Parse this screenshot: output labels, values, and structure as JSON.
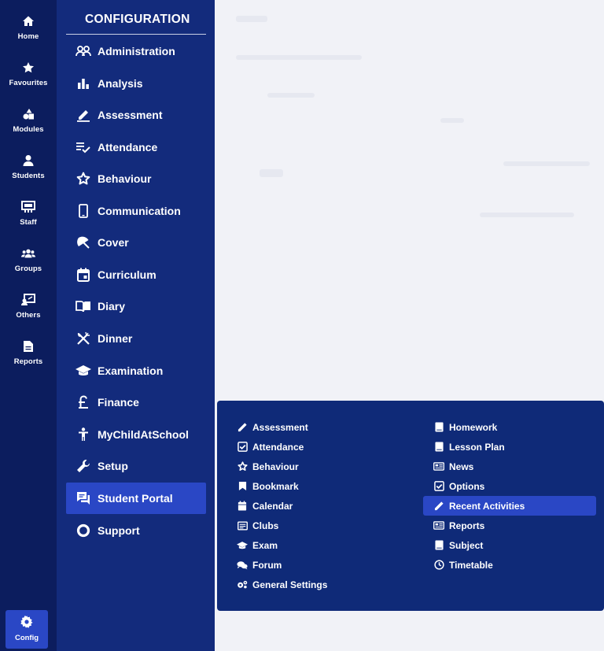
{
  "rail": {
    "items": [
      {
        "label": "Home",
        "icon": "home-icon"
      },
      {
        "label": "Favourites",
        "icon": "star-icon"
      },
      {
        "label": "Modules",
        "icon": "modules-icon"
      },
      {
        "label": "Students",
        "icon": "person-icon"
      },
      {
        "label": "Staff",
        "icon": "staff-icon"
      },
      {
        "label": "Groups",
        "icon": "groups-icon"
      },
      {
        "label": "Others",
        "icon": "others-icon"
      },
      {
        "label": "Reports",
        "icon": "document-icon"
      }
    ],
    "config": {
      "label": "Config",
      "icon": "gear-icon"
    }
  },
  "panel": {
    "title": "CONFIGURATION",
    "items": [
      {
        "label": "Administration",
        "icon": "people-icon"
      },
      {
        "label": "Analysis",
        "icon": "bar-chart-icon"
      },
      {
        "label": "Assessment",
        "icon": "pen-icon"
      },
      {
        "label": "Attendance",
        "icon": "checklist-icon"
      },
      {
        "label": "Behaviour",
        "icon": "star-outline-icon"
      },
      {
        "label": "Communication",
        "icon": "phone-icon"
      },
      {
        "label": "Cover",
        "icon": "umbrella-icon"
      },
      {
        "label": "Curriculum",
        "icon": "calendar-icon"
      },
      {
        "label": "Diary",
        "icon": "book-open-icon"
      },
      {
        "label": "Dinner",
        "icon": "cutlery-icon"
      },
      {
        "label": "Examination",
        "icon": "graduation-cap-icon"
      },
      {
        "label": "Finance",
        "icon": "pound-icon"
      },
      {
        "label": "MyChildAtSchool",
        "icon": "child-icon"
      },
      {
        "label": "Setup",
        "icon": "wrench-icon"
      },
      {
        "label": "Student Portal",
        "icon": "chat-icon",
        "active": true
      },
      {
        "label": "Support",
        "icon": "ring-icon"
      }
    ]
  },
  "submenu": {
    "left": [
      {
        "label": "Assessment",
        "icon": "pencil-icon"
      },
      {
        "label": "Attendance",
        "icon": "checkbox-icon"
      },
      {
        "label": "Behaviour",
        "icon": "star-outline-icon"
      },
      {
        "label": "Bookmark",
        "icon": "bookmark-icon"
      },
      {
        "label": "Calendar",
        "icon": "calendar-icon"
      },
      {
        "label": "Clubs",
        "icon": "list-box-icon"
      },
      {
        "label": "Exam",
        "icon": "graduation-cap-icon"
      },
      {
        "label": "Forum",
        "icon": "comments-icon"
      },
      {
        "label": "General Settings",
        "icon": "gears-icon"
      }
    ],
    "right": [
      {
        "label": "Homework",
        "icon": "book-icon"
      },
      {
        "label": "Lesson Plan",
        "icon": "book-icon"
      },
      {
        "label": "News",
        "icon": "newspaper-icon"
      },
      {
        "label": "Options",
        "icon": "checkbox-icon"
      },
      {
        "label": "Recent Activities",
        "icon": "pencil-icon",
        "active": true
      },
      {
        "label": "Reports",
        "icon": "newspaper-icon"
      },
      {
        "label": "Subject",
        "icon": "book-icon"
      },
      {
        "label": "Timetable",
        "icon": "clock-icon"
      }
    ]
  },
  "colors": {
    "rail": "#0c1d5e",
    "panel": "#132b7c",
    "flyout": "#0f2a78",
    "active": "#2a47c5",
    "background": "#f1f2f7"
  }
}
